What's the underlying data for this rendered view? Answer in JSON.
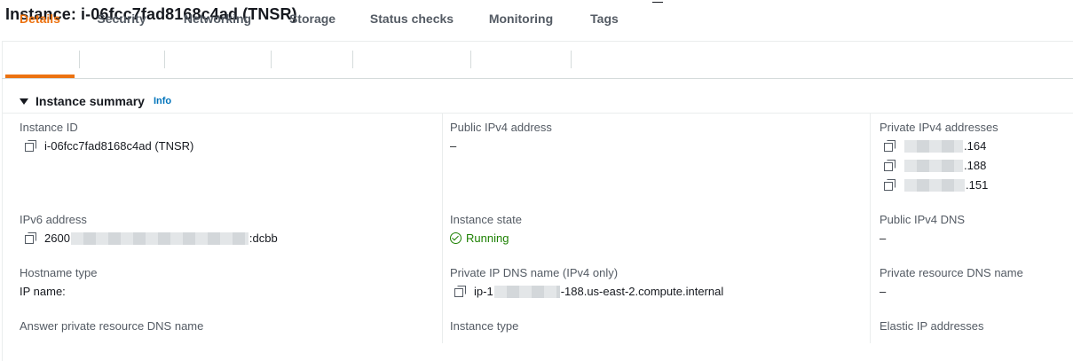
{
  "page": {
    "title": "Instance: i-06fcc7fad8168c4ad (TNSR)"
  },
  "tabs": [
    {
      "label": "Details"
    },
    {
      "label": "Security"
    },
    {
      "label": "Networking"
    },
    {
      "label": "Storage"
    },
    {
      "label": "Status checks"
    },
    {
      "label": "Monitoring"
    },
    {
      "label": "Tags"
    }
  ],
  "section": {
    "title": "Instance summary",
    "info": "Info"
  },
  "fields": {
    "instance_id": {
      "label": "Instance ID",
      "value": "i-06fcc7fad8168c4ad (TNSR)"
    },
    "public_ipv4": {
      "label": "Public IPv4 address",
      "value": "–"
    },
    "private_ipv4": {
      "label": "Private IPv4 addresses",
      "values": [
        ".164",
        ".188",
        ".151"
      ]
    },
    "ipv6": {
      "label": "IPv6 address",
      "prefix": "2600",
      "suffix": ":dcbb"
    },
    "instance_state": {
      "label": "Instance state",
      "value": "Running"
    },
    "public_ipv4_dns": {
      "label": "Public IPv4 DNS",
      "value": "–"
    },
    "hostname_type": {
      "label": "Hostname type",
      "value": "IP name:"
    },
    "private_ip_dns": {
      "label": "Private IP DNS name (IPv4 only)",
      "prefix": "ip-1",
      "suffix": "-188.us-east-2.compute.internal"
    },
    "private_resource_dns": {
      "label": "Private resource DNS name",
      "value": "–"
    },
    "answer_private_dns": {
      "label": "Answer private resource DNS name"
    },
    "instance_type": {
      "label": "Instance type"
    },
    "elastic_ip": {
      "label": "Elastic IP addresses"
    }
  },
  "colors": {
    "accent": "#ec7211",
    "link": "#0073bb",
    "success": "#1d8102"
  }
}
